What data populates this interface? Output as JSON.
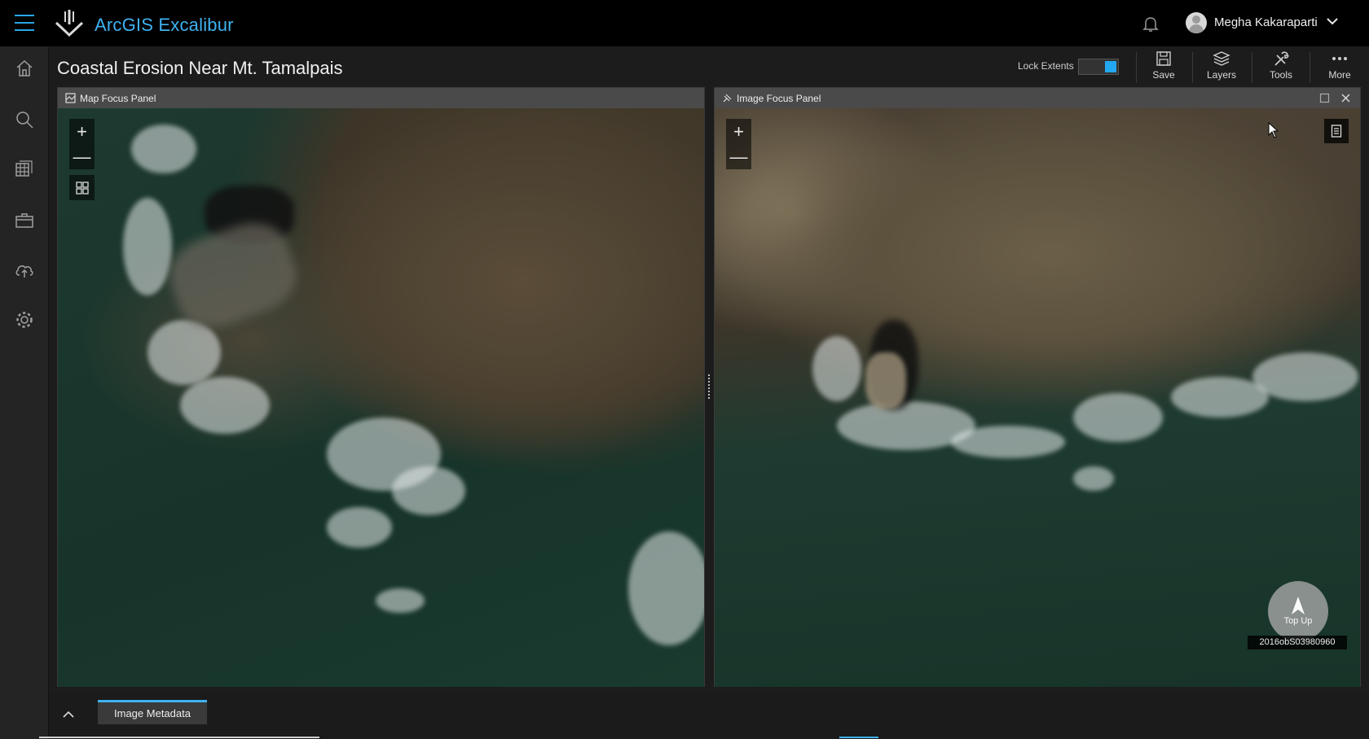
{
  "header": {
    "app_title": "ArcGIS Excalibur",
    "user_name": "Megha Kakaraparti",
    "brand_color": "#3fb2f0"
  },
  "sidebar": {
    "items": [
      {
        "name": "home",
        "icon": "home-icon"
      },
      {
        "name": "search",
        "icon": "search-icon"
      },
      {
        "name": "catalog",
        "icon": "image-stack-icon"
      },
      {
        "name": "projects",
        "icon": "briefcase-icon"
      },
      {
        "name": "upload",
        "icon": "cloud-upload-icon"
      },
      {
        "name": "settings",
        "icon": "gear-icon"
      }
    ]
  },
  "toolbar": {
    "page_title": "Coastal Erosion Near Mt. Tamalpais",
    "lock_extents_label": "Lock Extents",
    "lock_extents_on": true,
    "buttons": [
      {
        "label": "Save",
        "icon": "save-icon"
      },
      {
        "label": "Layers",
        "icon": "layers-icon"
      },
      {
        "label": "Tools",
        "icon": "tools-icon"
      },
      {
        "label": "More",
        "icon": "more-dots-icon"
      }
    ]
  },
  "map_panel": {
    "title": "Map Focus Panel",
    "zoom_in": "+",
    "zoom_out": "—"
  },
  "image_panel": {
    "title": "Image Focus Panel",
    "zoom_in": "+",
    "zoom_out": "—",
    "top_up_label": "Top Up",
    "image_id": "2016obS03980960"
  },
  "bottom": {
    "metadata_tab": "Image Metadata"
  }
}
